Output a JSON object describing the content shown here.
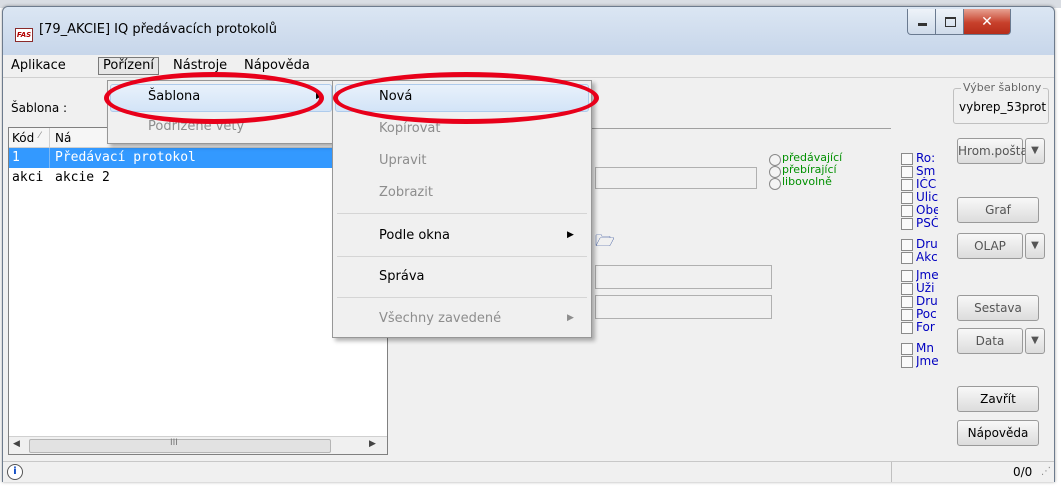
{
  "window": {
    "title": "[79_AKCIE] IQ předávacích protokolů",
    "logo": "FAS"
  },
  "menubar": [
    "Aplikace",
    "Pořízení",
    "Nástroje",
    "Nápověda"
  ],
  "toolbar": {
    "sablona_label": "Šablona :"
  },
  "list": {
    "columns": [
      "Kód",
      "Ná"
    ],
    "rows": [
      {
        "kod": "1",
        "nazev": "Předávací protokol",
        "selected": true
      },
      {
        "kod": "akci",
        "nazev": "akcie 2",
        "selected": false
      }
    ]
  },
  "radios": [
    "předávající",
    "přebírající",
    "libovolně"
  ],
  "checkboxes": [
    "Ro:",
    "Sm",
    "IČC",
    "Ulic",
    "Obe",
    "PSČ",
    "Dru",
    "Akc",
    "Jme",
    "Uži",
    "Dru",
    "Poc",
    "For",
    "Mn",
    "Jme"
  ],
  "right_panel": {
    "group_title": "Výber šablony",
    "group_value": "vybrep_53prot",
    "buttons": {
      "hrom": "Hrom.pošta",
      "graf": "Graf",
      "olap": "OLAP",
      "sestava": "Sestava",
      "data": "Data",
      "zavrit": "Zavřít",
      "napoveda": "Nápověda"
    }
  },
  "status": {
    "count": "0/0"
  },
  "menu_porizeni": {
    "items": [
      {
        "label": "Šablona",
        "disabled": false,
        "submenu": true
      },
      {
        "label": "Podřízené věty",
        "disabled": true,
        "submenu": false
      }
    ]
  },
  "menu_sablona": {
    "items": [
      {
        "label": "Nová",
        "disabled": false
      },
      {
        "label": "Kopírovat",
        "disabled": true
      },
      {
        "label": "Upravit",
        "disabled": true
      },
      {
        "label": "Zobrazit",
        "disabled": true
      },
      {
        "label": "Podle okna",
        "disabled": false,
        "submenu": true
      },
      {
        "label": "Správa",
        "disabled": false
      },
      {
        "label": "Všechny zavedené",
        "disabled": true,
        "submenu": true
      }
    ]
  },
  "icons": {
    "folder": "open-folder-icon",
    "info": "info-icon"
  },
  "colors": {
    "selection": "#3399ff",
    "annotation": "#e8001a",
    "checkbox_label": "#0000c0",
    "radio_label": "#009000"
  }
}
